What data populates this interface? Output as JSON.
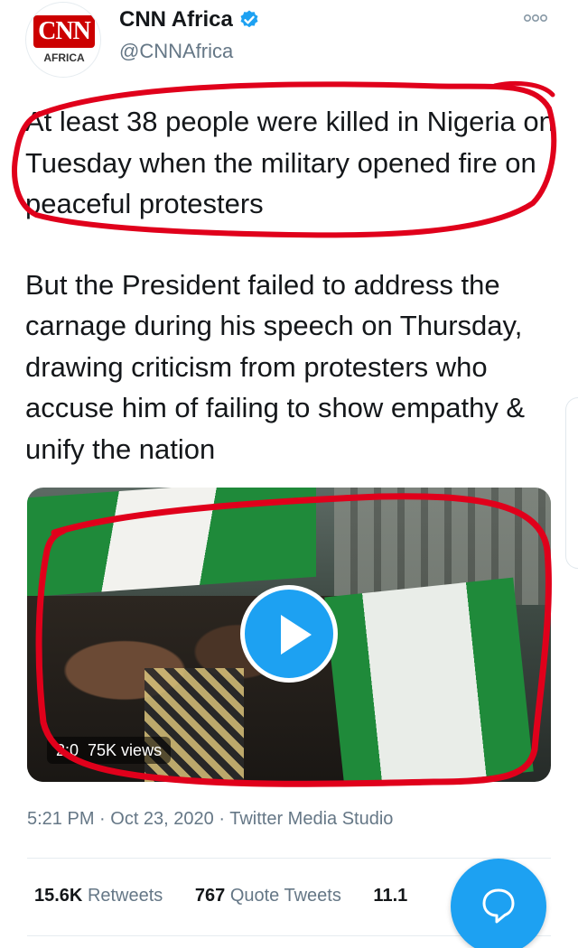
{
  "author": {
    "name": "CNN Africa",
    "handle": "@CNNAfrica",
    "logo_text": "CNN",
    "logo_subtext": "AFRICA",
    "verified": true
  },
  "tweet": {
    "paragraph_1": "At least 38 people were killed in Nigeria on Tuesday when the military opened fire on peaceful protesters",
    "paragraph_2": "But the President failed to address the carnage during his speech on Thursday, drawing criticism from protesters who accuse him of failing to show empathy & unify the nation"
  },
  "media": {
    "duration": "2:0",
    "views": "75K views"
  },
  "meta": {
    "time": "5:21 PM",
    "date": "Oct 23, 2020",
    "source": "Twitter Media Studio"
  },
  "stats": {
    "retweets_count": "15.6K",
    "retweets_label": "Retweets",
    "quote_count": "767",
    "quote_label": "Quote Tweets",
    "likes_count": "11.1"
  },
  "colors": {
    "accent": "#1da1f2",
    "annotation": "#e0001b",
    "text": "#14171a",
    "secondary": "#657786"
  },
  "icons": {
    "more": "more-dots-icon",
    "verified": "verified-badge-icon",
    "play": "play-icon",
    "compose": "chat-bubble-icon"
  }
}
